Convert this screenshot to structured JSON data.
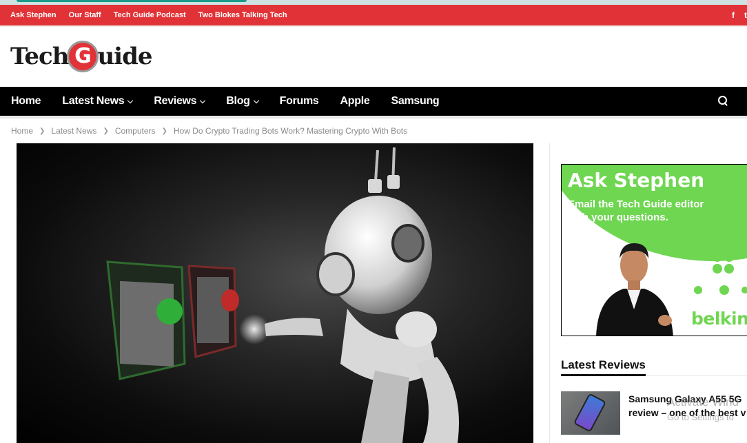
{
  "topbar": {
    "links": [
      "Ask Stephen",
      "Our Staff",
      "Tech Guide Podcast",
      "Two Blokes Talking Tech"
    ],
    "social": [
      "f",
      "t"
    ]
  },
  "logo": {
    "part1": "Tech",
    "g": "G",
    "part2": "uide"
  },
  "nav": {
    "items": [
      {
        "label": "Home",
        "has_dropdown": false
      },
      {
        "label": "Latest News",
        "has_dropdown": true
      },
      {
        "label": "Reviews",
        "has_dropdown": true
      },
      {
        "label": "Blog",
        "has_dropdown": true
      },
      {
        "label": "Forums",
        "has_dropdown": false
      },
      {
        "label": "Apple",
        "has_dropdown": false
      },
      {
        "label": "Samsung",
        "has_dropdown": false
      }
    ],
    "search_icon": "search-icon"
  },
  "breadcrumb": [
    "Home",
    "Latest News",
    "Computers",
    "How Do Crypto Trading Bots Work? Mastering Crypto With Bots"
  ],
  "ad": {
    "title": "Ask Stephen",
    "subtitle": "Email the Tech Guide editor with your questions.",
    "brand": "belkin",
    "accent_color": "#6fd651"
  },
  "latest_reviews": {
    "heading": "Latest Reviews",
    "items": [
      {
        "title_line1": "Samsung Galaxy A55 5G",
        "title_line2": "review – one of the best v"
      }
    ]
  },
  "watermark": {
    "line1": "Activate Wind",
    "line2": "Go to Settings to"
  },
  "colors": {
    "brand_red": "#e13337",
    "nav_bg": "#000000"
  }
}
